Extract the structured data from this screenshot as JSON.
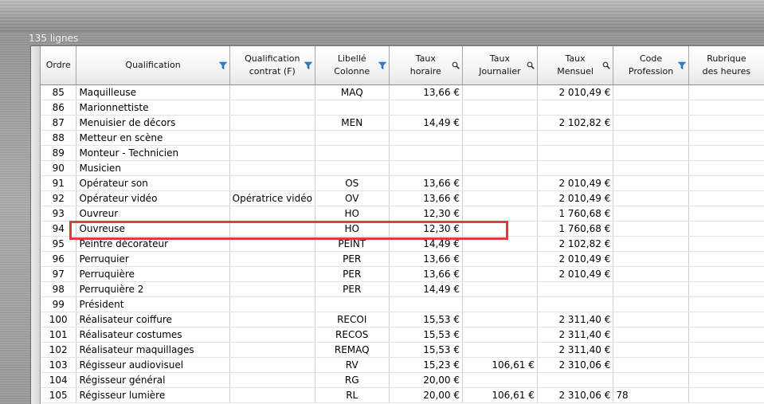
{
  "header": {
    "row_count_label": "135 lignes"
  },
  "colors": {
    "filter_icon": "#2d7fd3",
    "highlight": "#e5393b"
  },
  "columns": [
    {
      "key": "ordre",
      "label": "Ordre",
      "icon": ""
    },
    {
      "key": "qualification",
      "label": "Qualification",
      "icon": "filter-icon"
    },
    {
      "key": "qualification_contrat",
      "label": "Qualification\ncontrat (F)",
      "icon": "filter-icon"
    },
    {
      "key": "libelle_colonne",
      "label": "Libellé\nColonne",
      "icon": "filter-icon"
    },
    {
      "key": "taux_horaire",
      "label": "Taux\nhoraire",
      "icon": "search-icon"
    },
    {
      "key": "taux_journalier",
      "label": "Taux\nJournalier",
      "icon": "search-icon"
    },
    {
      "key": "taux_mensuel",
      "label": "Taux\nMensuel",
      "icon": "search-icon"
    },
    {
      "key": "code_profession",
      "label": "Code\nProfession",
      "icon": "filter-icon"
    },
    {
      "key": "rubrique_heures",
      "label": "Rubrique\ndes heures",
      "icon": ""
    }
  ],
  "rows": [
    [
      "85",
      "Maquilleuse",
      "",
      "MAQ",
      "13,66 €",
      "",
      "2 010,49 €",
      "",
      ""
    ],
    [
      "86",
      "Marionnettiste",
      "",
      "",
      "",
      "",
      "",
      "",
      ""
    ],
    [
      "87",
      "Menuisier de décors",
      "",
      "MEN",
      "14,49 €",
      "",
      "2 102,82 €",
      "",
      ""
    ],
    [
      "88",
      "Metteur en scène",
      "",
      "",
      "",
      "",
      "",
      "",
      ""
    ],
    [
      "89",
      "Monteur - Technicien",
      "",
      "",
      "",
      "",
      "",
      "",
      ""
    ],
    [
      "90",
      "Musicien",
      "",
      "",
      "",
      "",
      "",
      "",
      ""
    ],
    [
      "91",
      "Opérateur son",
      "",
      "OS",
      "13,66 €",
      "",
      "2 010,49 €",
      "",
      ""
    ],
    [
      "92",
      "Opérateur vidéo",
      "Opératrice vidéo",
      "OV",
      "13,66 €",
      "",
      "2 010,49 €",
      "",
      ""
    ],
    [
      "93",
      "Ouvreur",
      "",
      "HO",
      "12,30 €",
      "",
      "1 760,68 €",
      "",
      ""
    ],
    [
      "94",
      "Ouvreuse",
      "",
      "HO",
      "12,30 €",
      "",
      "1 760,68 €",
      "",
      ""
    ],
    [
      "95",
      "Peintre décorateur",
      "",
      "PEINT",
      "14,49 €",
      "",
      "2 102,82 €",
      "",
      ""
    ],
    [
      "96",
      "Perruquier",
      "",
      "PER",
      "13,66 €",
      "",
      "2 010,49 €",
      "",
      ""
    ],
    [
      "97",
      "Perruquière",
      "",
      "PER",
      "13,66 €",
      "",
      "2 010,49 €",
      "",
      ""
    ],
    [
      "98",
      "Perruquière 2",
      "",
      "PER",
      "14,49 €",
      "",
      "",
      "",
      ""
    ],
    [
      "99",
      "Président",
      "",
      "",
      "",
      "",
      "",
      "",
      ""
    ],
    [
      "100",
      "Réalisateur coiffure",
      "",
      "RECOI",
      "15,53 €",
      "",
      "2 311,40 €",
      "",
      ""
    ],
    [
      "101",
      "Réalisateur costumes",
      "",
      "RECOS",
      "15,53 €",
      "",
      "2 311,40 €",
      "",
      ""
    ],
    [
      "102",
      "Réalisateur maquillages",
      "",
      "REMAQ",
      "15,53 €",
      "",
      "2 311,40 €",
      "",
      ""
    ],
    [
      "103",
      "Régisseur audiovisuel",
      "",
      "RV",
      "15,23 €",
      "106,61 €",
      "2 310,06 €",
      "",
      ""
    ],
    [
      "104",
      "Régisseur général",
      "",
      "RG",
      "20,00 €",
      "",
      "",
      "",
      ""
    ],
    [
      "105",
      "Régisseur lumière",
      "",
      "RL",
      "20,00 €",
      "106,61 €",
      "2 310,06 €",
      "78",
      ""
    ]
  ]
}
